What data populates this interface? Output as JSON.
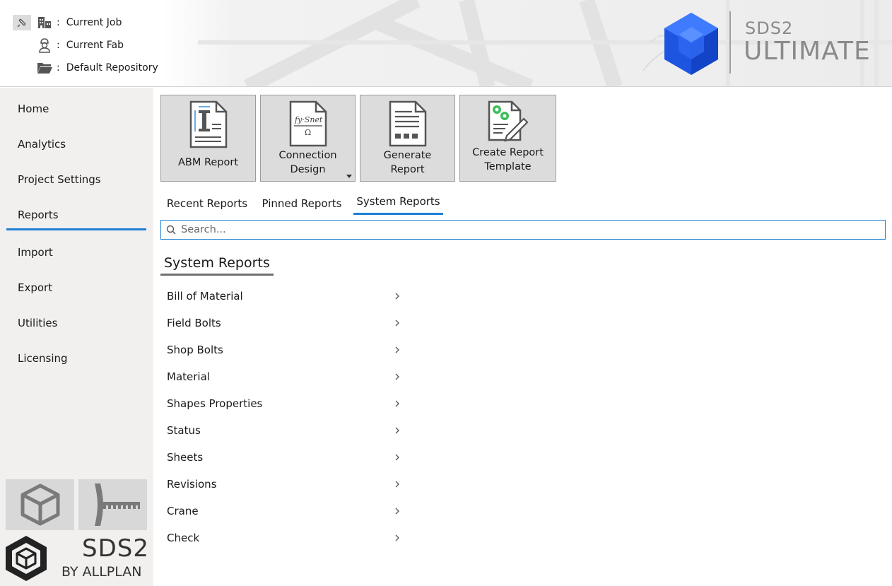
{
  "header": {
    "context": [
      {
        "icon": "building-icon",
        "label": "Current Job"
      },
      {
        "icon": "worker-icon",
        "label": "Current Fab"
      },
      {
        "icon": "folder-icon",
        "label": "Default Repository"
      }
    ],
    "separator": ":",
    "brand": {
      "line1": "SDS2",
      "line2": "ULTIMATE",
      "logo_color": "#1f5fe0"
    }
  },
  "sidebar": {
    "items": [
      "Home",
      "Analytics",
      "Project Settings",
      "Reports",
      "Import",
      "Export",
      "Utilities",
      "Licensing"
    ],
    "active": "Reports",
    "footer": {
      "wordmark": "SDS2",
      "byline": "BY ALLPLAN"
    }
  },
  "toolbar": {
    "buttons": [
      {
        "icon": "abm-report-icon",
        "label_lines": [
          "ABM Report"
        ]
      },
      {
        "icon": "connection-design-icon",
        "label_lines": [
          "Connection",
          "Design"
        ],
        "has_dropdown": true
      },
      {
        "icon": "generate-report-icon",
        "label_lines": [
          "Generate",
          "Report"
        ]
      },
      {
        "icon": "create-template-icon",
        "label_lines": [
          "Create Report",
          "Template"
        ]
      }
    ],
    "formula_text": "fy·Snet / Ω"
  },
  "tabs": {
    "items": [
      "Recent Reports",
      "Pinned Reports",
      "System Reports"
    ],
    "active": "System Reports"
  },
  "search": {
    "placeholder": "Search...",
    "value": ""
  },
  "section": {
    "title": "System Reports",
    "reports": [
      "Bill of Material",
      "Field Bolts",
      "Shop Bolts",
      "Material",
      "Shapes Properties",
      "Status",
      "Sheets",
      "Revisions",
      "Crane",
      "Check"
    ]
  },
  "colors": {
    "accent": "#1f7fd6",
    "sidebar_bg": "#f1f0ef",
    "button_bg": "#dcdcdc"
  }
}
